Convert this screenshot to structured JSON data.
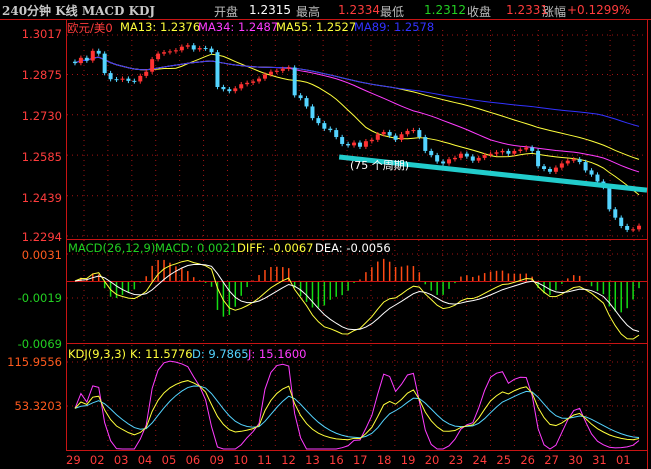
{
  "header": {
    "title": "240分钟 K线 MACD KDJ",
    "open_label": "开盘",
    "open": "1.2315",
    "high_label": "最高",
    "high": "1.2334",
    "low_label": "最低",
    "low": "1.2312",
    "close_label": "收盘",
    "close": "1.2331",
    "change_label": "涨幅",
    "change": "+0.1299%"
  },
  "colors": {
    "up": "#ff3232",
    "down": "#54d4ff",
    "ma13": "#ffff3c",
    "ma34": "#ff3cff",
    "ma55": "#ffff3c",
    "ma89": "#3232ff",
    "trendline": "#22cccc",
    "grid": "#a01414"
  },
  "chart_data": [
    {
      "type": "candlestick",
      "symbol": "欧元/美0",
      "legend": {
        "ma13": "MA13: 1.2376",
        "ma34": "MA34: 1.2487",
        "ma55": "MA55: 1.2527",
        "ma89": "MA89: 1.2578"
      },
      "y_ticks": [
        "1.3017",
        "1.2875",
        "1.2730",
        "1.2585",
        "1.2439",
        "1.2294"
      ],
      "ylim": [
        1.2294,
        1.3017
      ],
      "x_tick_labels": [
        "29",
        "02",
        "03",
        "04",
        "05",
        "06",
        "09",
        "10",
        "11",
        "12",
        "13",
        "16",
        "17",
        "18",
        "19",
        "20",
        "23",
        "24",
        "25",
        "26",
        "27",
        "30",
        "31",
        "01"
      ],
      "closes": [
        1.2916,
        1.2935,
        1.2925,
        1.296,
        1.295,
        1.288,
        1.2858,
        1.2856,
        1.286,
        1.2852,
        1.285,
        1.287,
        1.2885,
        1.293,
        1.295,
        1.2955,
        1.2958,
        1.2962,
        1.2975,
        1.298,
        1.2965,
        1.297,
        1.2968,
        1.2955,
        1.283,
        1.2822,
        1.2815,
        1.2825,
        1.284,
        1.2845,
        1.285,
        1.286,
        1.2875,
        1.2885,
        1.2888,
        1.2895,
        1.29,
        1.28,
        1.279,
        1.276,
        1.2718,
        1.27,
        1.268,
        1.2675,
        1.265,
        1.2625,
        1.262,
        1.263,
        1.2615,
        1.2635,
        1.264,
        1.266,
        1.2668,
        1.2655,
        1.264,
        1.266,
        1.2672,
        1.2675,
        1.265,
        1.26,
        1.2585,
        1.2562,
        1.2555,
        1.257,
        1.2575,
        1.259,
        1.258,
        1.2565,
        1.2575,
        1.2585,
        1.259,
        1.2595,
        1.26,
        1.259,
        1.26,
        1.2605,
        1.2612,
        1.26,
        1.2545,
        1.2535,
        1.2525,
        1.254,
        1.2555,
        1.2565,
        1.257,
        1.256,
        1.253,
        1.2515,
        1.249,
        1.247,
        1.239,
        1.236,
        1.233,
        1.2316,
        1.2318,
        1.2331
      ],
      "moving_averages": [
        13,
        34,
        55,
        89
      ],
      "trendline": {
        "label": "(75 个周期)",
        "start_index": 45,
        "start_price": 1.2578,
        "end_index": 96,
        "end_price": 1.2459
      }
    },
    {
      "type": "macd",
      "title": "MACD(26,12,9)",
      "macd": "MACD: 0.0021",
      "diff": "DIFF: -0.0067",
      "dea": "DEA: -0.0056",
      "y_ticks": [
        "0.0031",
        "-0.0019",
        "-0.0069"
      ],
      "ylim": [
        -0.0069,
        0.0031
      ]
    },
    {
      "type": "kdj",
      "title": "KDJ(9,3,3)",
      "k": "K: 11.5776",
      "d": "D: 9.7865",
      "j": "J: 15.1600",
      "y_ticks": [
        "115.9556",
        "53.3203"
      ]
    }
  ]
}
